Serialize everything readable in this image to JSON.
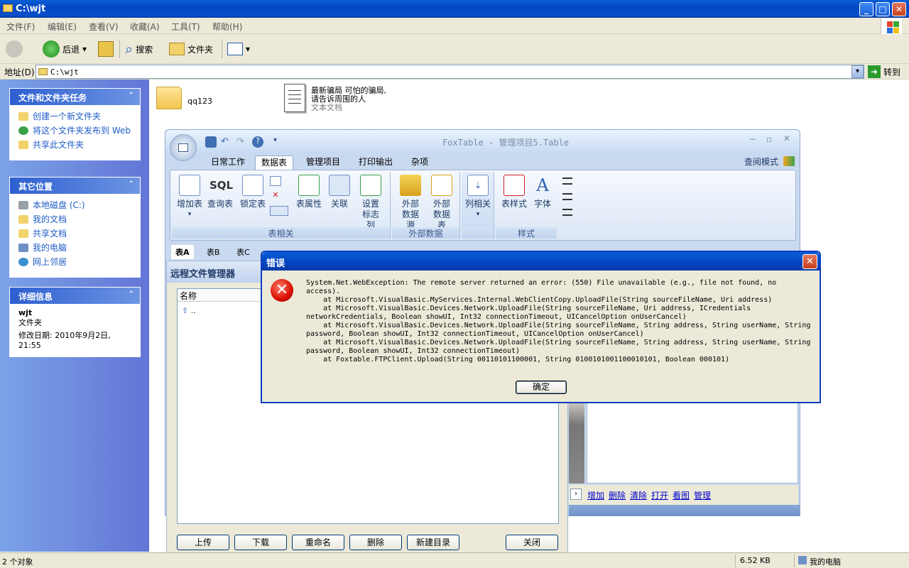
{
  "window": {
    "title": "C:\\wjt",
    "min": "_",
    "max": "□",
    "close": "✕"
  },
  "menu": [
    "文件(F)",
    "编辑(E)",
    "查看(V)",
    "收藏(A)",
    "工具(T)",
    "帮助(H)"
  ],
  "toolbar": {
    "back": "后退",
    "search": "搜索",
    "folders": "文件夹"
  },
  "address": {
    "label": "地址(D)",
    "value": "C:\\wjt",
    "go": "转到"
  },
  "taskpane": {
    "tasks": {
      "title": "文件和文件夹任务",
      "items": [
        "创建一个新文件夹",
        "将这个文件夹发布到 Web",
        "共享此文件夹"
      ]
    },
    "other": {
      "title": "其它位置",
      "items": [
        "本地磁盘 (C:)",
        "我的文档",
        "共享文档",
        "我的电脑",
        "网上邻居"
      ]
    },
    "details": {
      "title": "详细信息",
      "name": "wjt",
      "type": "文件夹",
      "modified": "修改日期: 2010年9月2日, 21:55"
    }
  },
  "files": [
    {
      "name": "qq123"
    },
    {
      "name": "最新骗局 可怕的骗局,请告诉周围的人",
      "type": "文本文档"
    }
  ],
  "foxtable": {
    "title": "FoxTable - 管理项目5.Table",
    "mode": "查阅模式",
    "tabs": [
      "日常工作",
      "数据表",
      "管理项目",
      "打印输出",
      "杂项"
    ],
    "active_tab": "数据表",
    "groups": [
      {
        "label": "表相关",
        "buttons": [
          "增加表",
          "查询表",
          "锁定表",
          "表属性",
          "关联",
          "设置 标志列"
        ]
      },
      {
        "label": "外部数据",
        "buttons": [
          "外部 数据源",
          "外部 数据表"
        ]
      },
      {
        "label": "",
        "buttons": [
          "列相关"
        ]
      },
      {
        "label": "样式",
        "buttons": [
          "表样式",
          "字体"
        ]
      }
    ],
    "sql_text": "SQL",
    "sheets": [
      "表A",
      "表B",
      "表C"
    ],
    "footer_links": [
      "增加",
      "删除",
      "清除",
      "打开",
      "看图",
      "管理"
    ]
  },
  "rfm": {
    "title": "远程文件管理器",
    "column": "名称",
    "parent_row": "..",
    "buttons": [
      "上传",
      "下载",
      "重命名",
      "删除",
      "新建目录"
    ],
    "close": "关闭"
  },
  "error": {
    "title": "错误",
    "message": "System.Net.WebException: The remote server returned an error: (550) File unavailable (e.g., file not found, no access).\n    at Microsoft.VisualBasic.MyServices.Internal.WebClientCopy.UploadFile(String sourceFileName, Uri address)\n    at Microsoft.VisualBasic.Devices.Network.UploadFile(String sourceFileName, Uri address, ICredentials\nnetworkCredentials, Boolean showUI, Int32 connectionTimeout, UICancelOption onUserCancel)\n    at Microsoft.VisualBasic.Devices.Network.UploadFile(String sourceFileName, String address, String userName, String\npassword, Boolean showUI, Int32 connectionTimeout, UICancelOption onUserCancel)\n    at Microsoft.VisualBasic.Devices.Network.UploadFile(String sourceFileName, String address, String userName, String\npassword, Boolean showUI, Int32 connectionTimeout)\n    at Foxtable.FTPClient.Upload(String 00110101100001, String 0100101001100010101, Boolean 000101)",
    "ok": "确定"
  },
  "status": {
    "count": "2 个对象",
    "size": "6.52 KB",
    "location": "我的电脑"
  }
}
